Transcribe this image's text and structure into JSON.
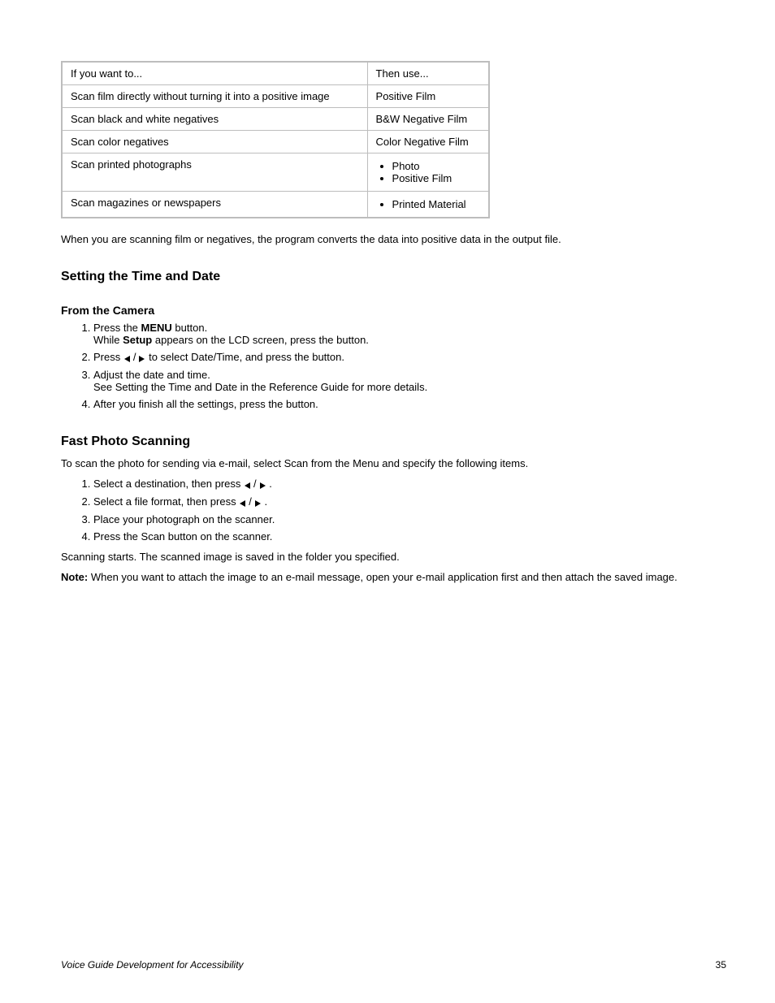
{
  "table": {
    "headers": [
      "If you want to...",
      "Then use..."
    ],
    "rows": [
      {
        "left": "Scan film directly without turning it into a positive image",
        "right": "Positive Film"
      },
      {
        "left": "Scan black and white negatives",
        "right": "B&W Negative Film"
      },
      {
        "left": "Scan color negatives",
        "right": "Color Negative Film"
      },
      {
        "left": "Scan printed photographs",
        "right_list": [
          "Photo",
          "Positive Film"
        ]
      },
      {
        "left": "Scan magazines or newspapers",
        "right_list": [
          "Printed Material"
        ]
      }
    ]
  },
  "after_table_text": "When you are scanning film or negatives, the program converts the data into positive data in the output file.",
  "sections": {
    "time_date": {
      "title": "Setting the Time and Date",
      "context_heading": "From the Camera",
      "steps": [
        {
          "prefix": "Press the ",
          "bold1": "MENU",
          "mid": " button.\nWhile ",
          "bold2": "Setup",
          "mid2": " appears on the LCD screen, press the ",
          "suffix": " button."
        },
        {
          "prefix": "Press [[ARROWS]] to select Date/Time, and press the ",
          "suffix": " button."
        },
        {
          "text": "Adjust the date and time.\nSee Setting the Time and Date in the Reference Guide for more details."
        },
        {
          "prefix": "After you finish all the settings, press the ",
          "suffix": " button."
        }
      ]
    },
    "fast_photo": {
      "title": "Fast Photo Scanning",
      "intro": "To scan the photo for sending via e-mail, select Scan from the Menu and specify the following items.",
      "steps": [
        {
          "text": "Select a destination, then press [[ARROWS]]."
        },
        {
          "text": "Select a file format, then press [[ARROWS]]."
        },
        {
          "text": "Place your photograph on the scanner."
        },
        {
          "text": "Press the Scan button on the scanner."
        }
      ],
      "after": "Scanning starts. The scanned image is saved in the folder you specified.",
      "note_label": "Note:",
      "note_text": "When you want to attach the image to an e-mail message, open your e-mail application first and then attach the saved image."
    }
  },
  "footer_left": "Voice Guide Development for Accessibility",
  "footer_right": "35"
}
